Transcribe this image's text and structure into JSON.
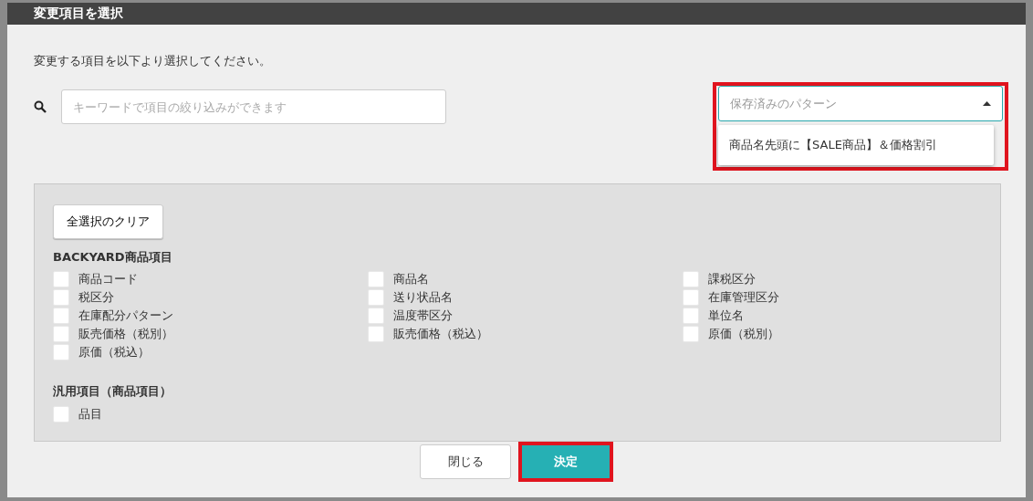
{
  "dialog": {
    "title": "変更項目を選択",
    "instruction": "変更する項目を以下より選択してください。"
  },
  "search": {
    "placeholder": "キーワードで項目の絞り込みができます"
  },
  "pattern_select": {
    "placeholder": "保存済みのパターン",
    "expanded": true,
    "highlighted": true,
    "options": [
      {
        "label": "商品名先頭に【SALE商品】＆価格割引"
      }
    ]
  },
  "clear_button": "全選択のクリア",
  "groups": [
    {
      "title": "BACKYARD商品項目",
      "items": [
        {
          "label": "商品コード",
          "checked": false
        },
        {
          "label": "商品名",
          "checked": false
        },
        {
          "label": "課税区分",
          "checked": false
        },
        {
          "label": "税区分",
          "checked": false
        },
        {
          "label": "送り状品名",
          "checked": false
        },
        {
          "label": "在庫管理区分",
          "checked": false
        },
        {
          "label": "在庫配分パターン",
          "checked": false
        },
        {
          "label": "温度帯区分",
          "checked": false
        },
        {
          "label": "単位名",
          "checked": false
        },
        {
          "label": "販売価格（税別）",
          "checked": false
        },
        {
          "label": "販売価格（税込）",
          "checked": false
        },
        {
          "label": "原価（税別）",
          "checked": false
        },
        {
          "label": "原価（税込）",
          "checked": false
        }
      ]
    },
    {
      "title": "汎用項目（商品項目）",
      "items": [
        {
          "label": "品目",
          "checked": false
        }
      ]
    }
  ],
  "footer": {
    "buttons": [
      {
        "label": "閉じる",
        "kind": "secondary",
        "highlighted": false
      },
      {
        "label": "決定",
        "kind": "primary",
        "highlighted": true
      }
    ]
  }
}
